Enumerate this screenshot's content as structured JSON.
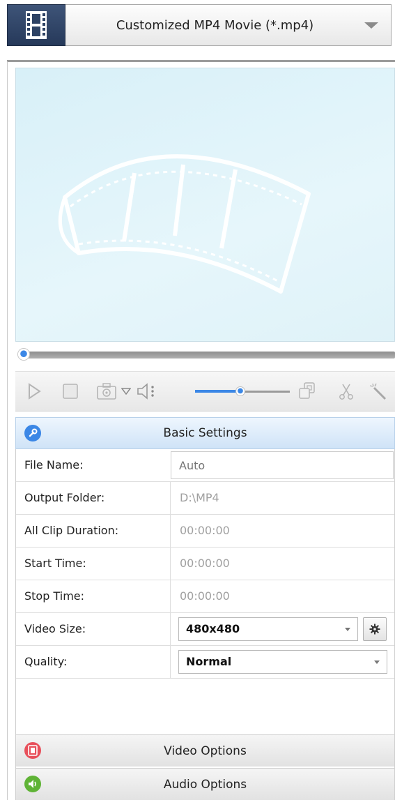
{
  "format": {
    "label": "Customized MP4 Movie (*.mp4)",
    "icon": "film-icon"
  },
  "preview": {
    "seek_fraction": 0.0
  },
  "toolbar": {
    "volume_fraction": 0.48,
    "icons": [
      "play-icon",
      "stop-icon",
      "snapshot-icon",
      "dropdown-icon",
      "volume-icon",
      "merge-icon",
      "cut-icon",
      "effect-wand-icon"
    ]
  },
  "basic_settings": {
    "title": "Basic Settings",
    "rows": {
      "file_name": {
        "label": "File Name:",
        "placeholder": "Auto"
      },
      "output_folder": {
        "label": "Output Folder:",
        "value": "D:\\MP4"
      },
      "all_clip_duration": {
        "label": "All Clip Duration:",
        "value": "00:00:00"
      },
      "start_time": {
        "label": "Start Time:",
        "value": "00:00:00"
      },
      "stop_time": {
        "label": "Stop Time:",
        "value": "00:00:00"
      },
      "video_size": {
        "label": "Video Size:",
        "value": "480x480"
      },
      "quality": {
        "label": "Quality:",
        "value": "Normal"
      }
    }
  },
  "sections": {
    "video_options": "Video Options",
    "audio_options": "Audio Options"
  },
  "colors": {
    "accent": "#3b87e6",
    "video_icon": "#e8505b",
    "audio_icon": "#5fb336"
  }
}
